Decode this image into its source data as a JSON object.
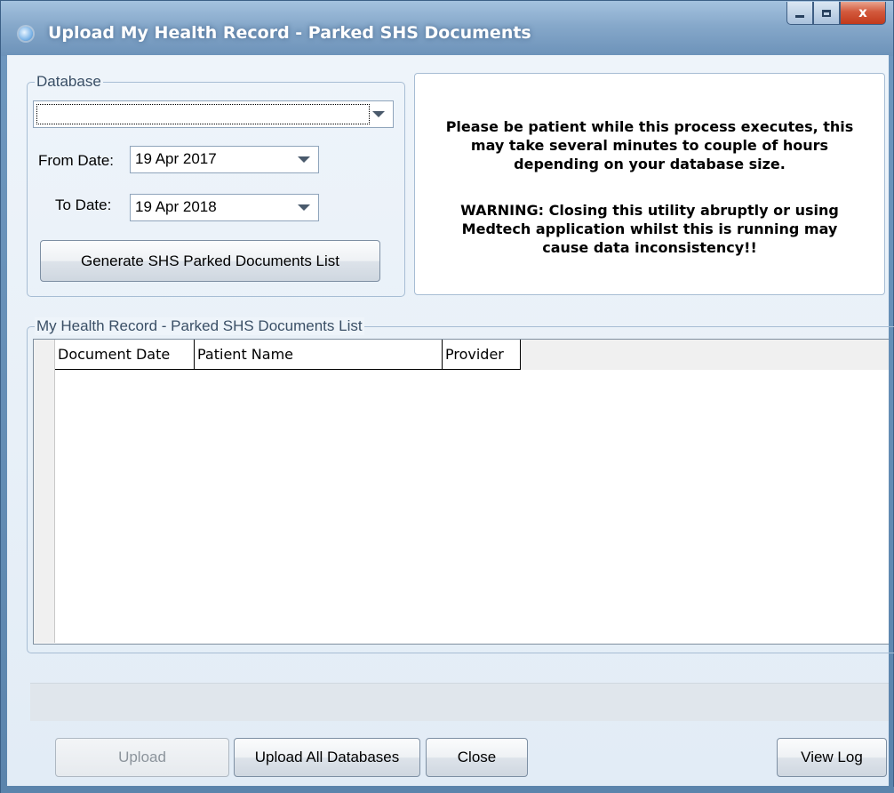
{
  "window": {
    "title": "Upload My Health Record - Parked SHS Documents",
    "close_glyph": "x"
  },
  "database_group": {
    "legend": "Database",
    "selected_value": "",
    "from_date_label": "From Date:",
    "from_date_value": "19 Apr 2017",
    "to_date_label": "To Date:",
    "to_date_value": "19 Apr 2018",
    "generate_label": "Generate SHS Parked Documents List"
  },
  "info": {
    "line1": "Please be patient while this process executes, this",
    "line2": "may take several minutes to couple of hours",
    "line3": "depending on your database size.",
    "warning1": "WARNING: Closing this utility abruptly or using",
    "warning2": "Medtech application whilst this is running may",
    "warning3": "cause data inconsistency!!"
  },
  "list_group": {
    "legend": "My Health Record - Parked SHS Documents List",
    "columns": [
      "Document Date",
      "Patient Name",
      "Provider"
    ],
    "rows": []
  },
  "buttons": {
    "upload": "Upload",
    "upload_all": "Upload All Databases",
    "close": "Close",
    "view_log": "View Log"
  },
  "colors": {
    "title_bar": "#86a8ca",
    "close_button": "#d3593c",
    "client_background": "#eef4fa"
  }
}
